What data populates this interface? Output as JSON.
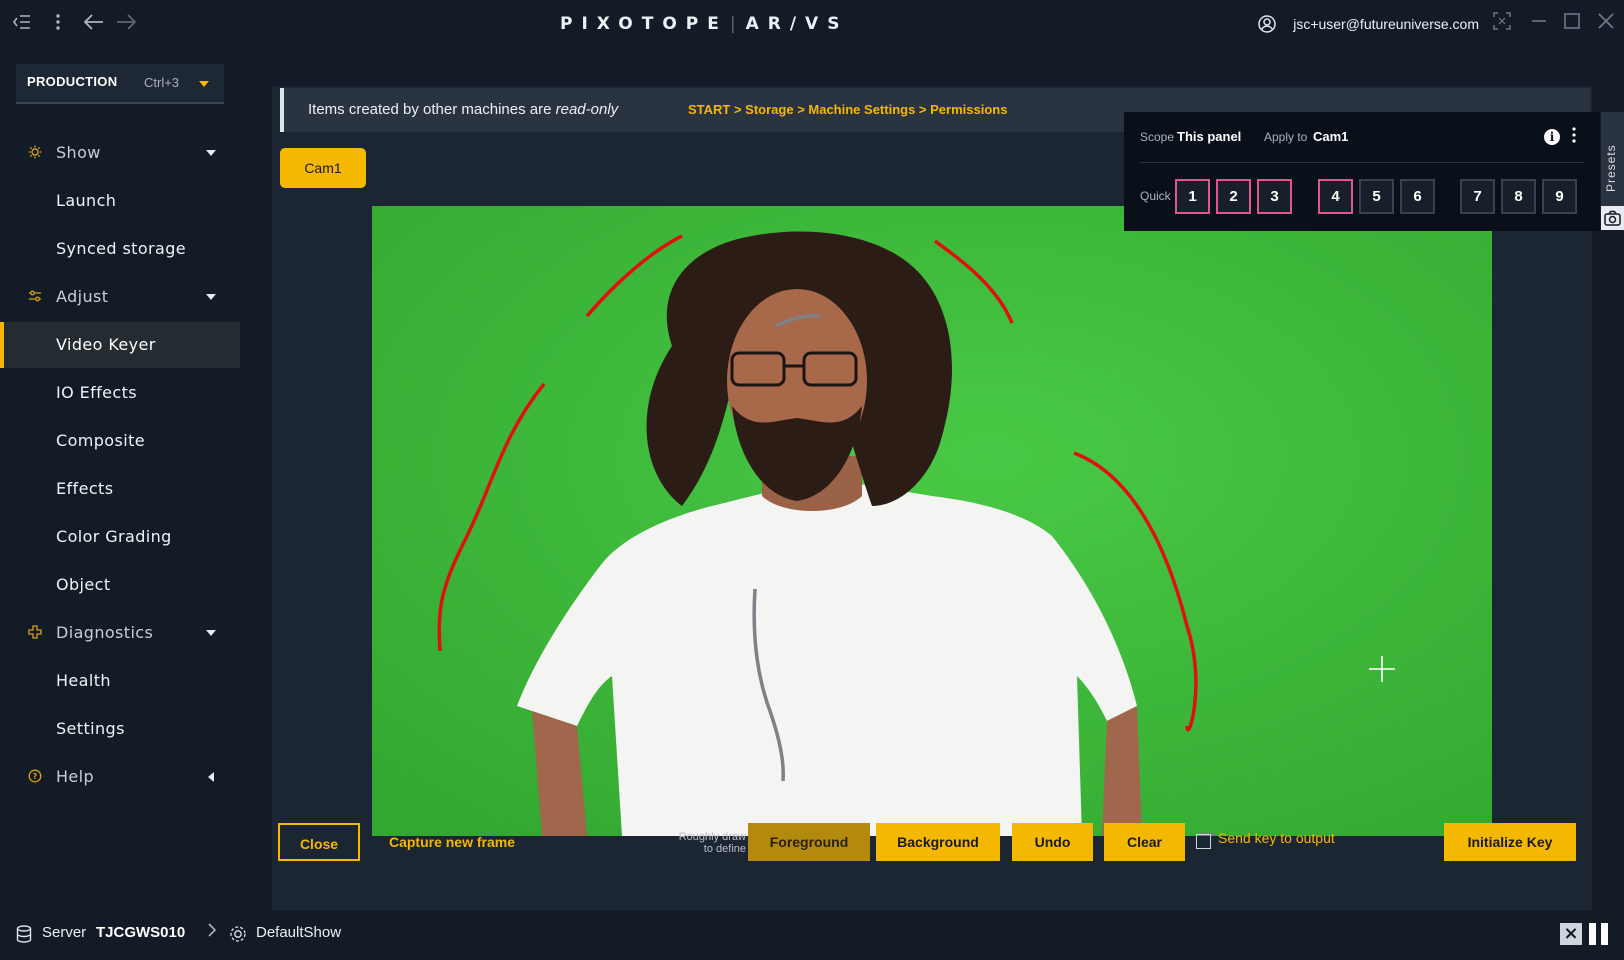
{
  "topbar": {
    "logo": "PIXOTOPE",
    "logo_sub": "AR/VS",
    "user": "jsc+user@futureuniverse.com"
  },
  "sidebar": {
    "production": {
      "label": "PRODUCTION",
      "shortcut": "Ctrl+3"
    },
    "groups": {
      "show": {
        "label": "Show",
        "items": [
          "Launch",
          "Synced storage"
        ]
      },
      "adjust": {
        "label": "Adjust",
        "items": [
          "Video Keyer",
          "IO Effects",
          "Composite",
          "Effects",
          "Color Grading",
          "Object"
        ]
      },
      "diagnostics": {
        "label": "Diagnostics",
        "items": [
          "Health",
          "Settings"
        ]
      },
      "help": {
        "label": "Help"
      }
    },
    "active_item": "Video Keyer"
  },
  "notice": {
    "text": "Items created by other machines are ",
    "emphasis": "read-only",
    "path": "START > Storage > Machine Settings > Permissions"
  },
  "camera_tab": "Cam1",
  "toolbar": {
    "close": "Close",
    "capture": "Capture new frame",
    "hint": "Roughly draw to define",
    "hint_line1": "Roughly draw",
    "hint_line2": "to define",
    "foreground": "Foreground",
    "background": "Background",
    "undo": "Undo",
    "clear": "Clear",
    "send_key": "Send key to output",
    "initialize": "Initialize Key"
  },
  "presets": {
    "scope_label": "Scope",
    "scope_value": "This panel",
    "apply_label": "Apply to",
    "apply_value": "Cam1",
    "quick_label": "Quick",
    "slots": [
      {
        "n": "1",
        "set": true
      },
      {
        "n": "2",
        "set": true
      },
      {
        "n": "3",
        "set": true
      },
      {
        "n": "4",
        "set": true
      },
      {
        "n": "5",
        "set": false
      },
      {
        "n": "6",
        "set": false
      },
      {
        "n": "7",
        "set": false
      },
      {
        "n": "8",
        "set": false
      },
      {
        "n": "9",
        "set": false
      }
    ],
    "tab_label": "Presets"
  },
  "statusbar": {
    "server_label": "Server",
    "server_name": "TJCGWS010",
    "show": "DefaultShow"
  },
  "colors": {
    "accent": "#f5b800",
    "preset_set_border": "#e0558a",
    "greenscreen": "#3fbb3c"
  }
}
